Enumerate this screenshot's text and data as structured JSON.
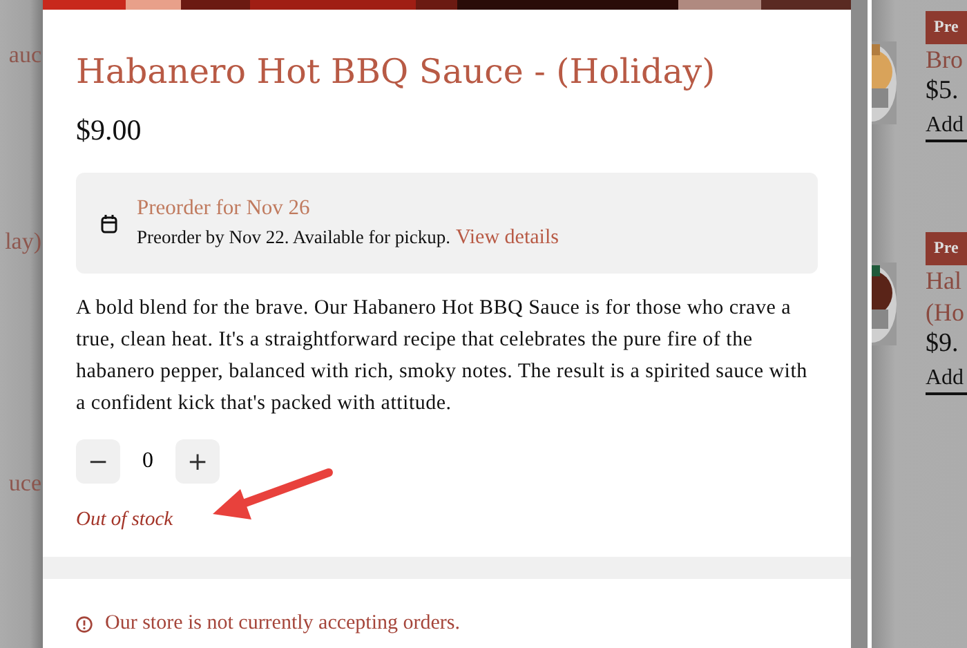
{
  "background_page": {
    "left_fragments": [
      "auc",
      "lay)",
      "uce"
    ],
    "right_products": [
      {
        "badge": "Pre",
        "name_lines": [
          "Bro"
        ],
        "price": "$5.",
        "action": "Add"
      },
      {
        "badge": "Pre",
        "name_lines": [
          "Hal",
          "(Ho"
        ],
        "price": "$9.",
        "action": "Add"
      }
    ]
  },
  "product_modal": {
    "title": "Habanero Hot BBQ Sauce - (Holiday)",
    "price": "$9.00",
    "preorder": {
      "heading": "Preorder for Nov 26",
      "text": "Preorder by Nov 22. Available for pickup.",
      "link": "View details"
    },
    "description": "A bold blend for the brave. Our Habanero Hot BBQ Sauce is for those who crave a true, clean heat. It's a straightforward recipe that celebrates the pure fire of the habanero pepper, balanced with rich, smoky notes. The result is a spirited sauce with a confident kick that's packed with attitude.",
    "quantity": {
      "decrease": "−",
      "value": "0",
      "increase": "+"
    },
    "stock_status": "Out of stock",
    "store_notice": "Our store is not currently accepting orders."
  }
}
